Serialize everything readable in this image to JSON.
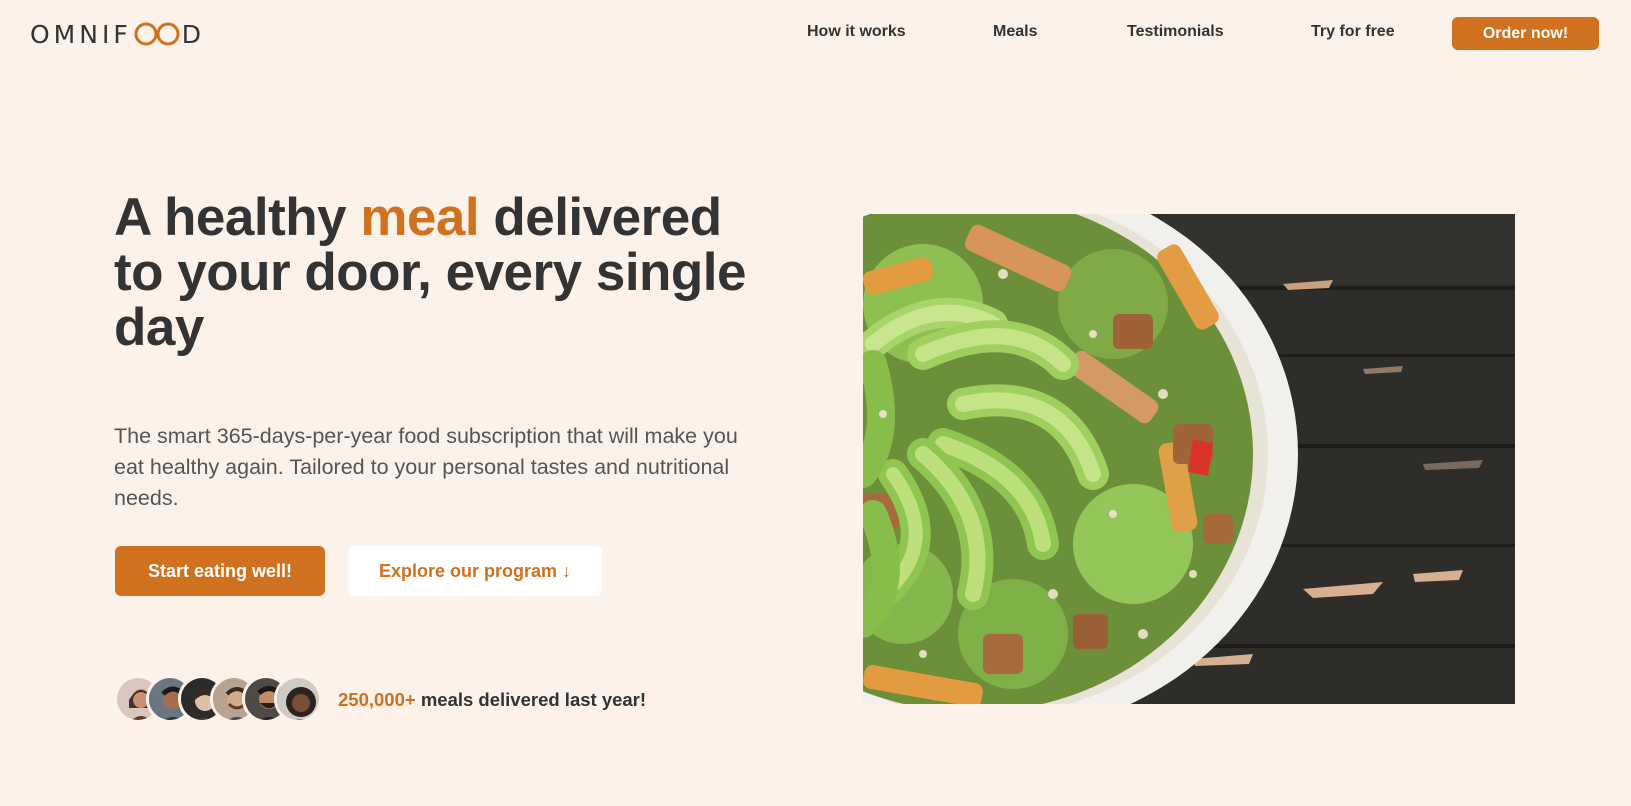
{
  "header": {
    "logo_left": "OMNIF",
    "logo_right": "D",
    "nav": [
      {
        "label": "How it works"
      },
      {
        "label": "Meals"
      },
      {
        "label": "Testimonials"
      },
      {
        "label": "Try for free"
      }
    ],
    "cta_label": "Order now!"
  },
  "hero": {
    "title_part1": "A healthy ",
    "title_accent": "meal",
    "title_part2": " delivered to your door, every single day",
    "description": "The smart 365-days-per-year food subscription that will make you eat healthy again. Tailored to your personal tastes and nutritional needs.",
    "primary_button": "Start eating well!",
    "secondary_button": "Explore our program ↓",
    "delivered_count": "250,000+",
    "delivered_text": " meals delivered last year!",
    "image_icon": "salad-bowl-photo"
  },
  "colors": {
    "background": "#fdf2e9",
    "accent": "#cf711f",
    "text": "#333333"
  }
}
